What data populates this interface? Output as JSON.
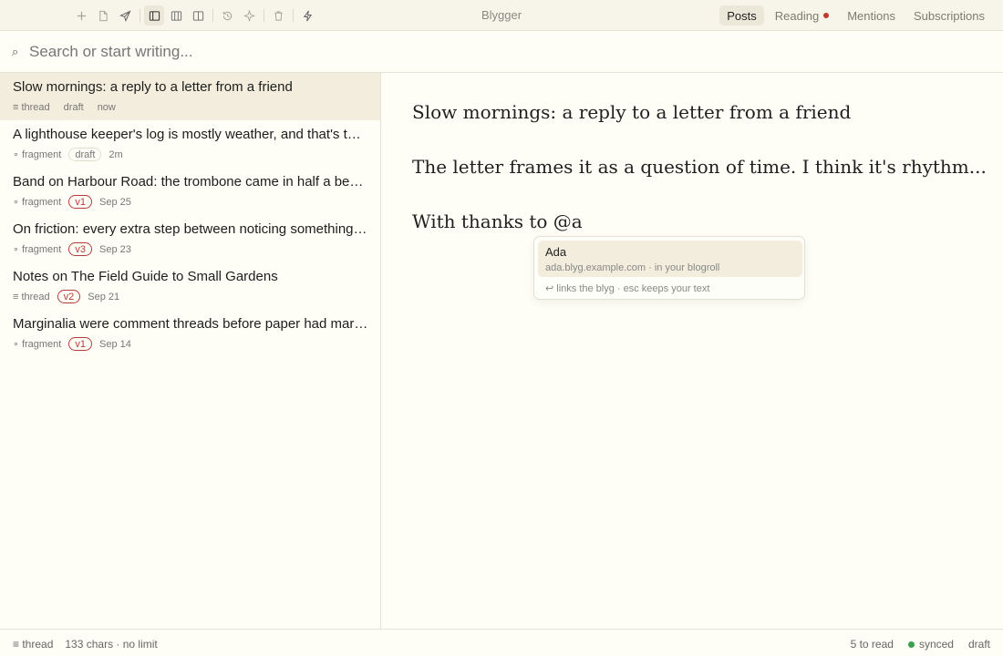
{
  "app": {
    "title": "Blygger"
  },
  "toolbar": {
    "icons": [
      "plus-icon",
      "document-icon",
      "send-icon",
      "sidebar-layout-icon",
      "columns-layout-icon",
      "split-layout-icon",
      "history-icon",
      "sparkle-icon",
      "trash-icon",
      "lightning-icon"
    ]
  },
  "nav": {
    "tabs": [
      {
        "label": "Posts",
        "active": true
      },
      {
        "label": "Reading",
        "active": false,
        "has_unread": true
      },
      {
        "label": "Mentions",
        "active": false
      },
      {
        "label": "Subscriptions",
        "active": false
      }
    ]
  },
  "colors": {
    "accent_red": "#b63b3b",
    "unread_dot": "#c0392b",
    "synced_dot": "#3aa04f",
    "selected_bg": "#f2eddc"
  },
  "search": {
    "placeholder": "Search or start writing...",
    "icon": "⌕"
  },
  "posts": [
    {
      "title": "Slow mornings: a reply to a letter from a friend",
      "kind": "≡ thread",
      "badge": "draft",
      "badge_type": "draft",
      "time": "now",
      "selected": true
    },
    {
      "title": "A lighthouse keeper's log is mostly weather, and that's the point",
      "kind": "∘ fragment",
      "badge": "draft",
      "badge_type": "draft",
      "time": "2m",
      "selected": false
    },
    {
      "title": "Band on Harbour Road: the trombone came in half a beat late",
      "kind": "∘ fragment",
      "badge": "v1",
      "badge_type": "ver",
      "time": "Sep 25",
      "selected": false
    },
    {
      "title": "On friction: every extra step between noticing something and writing it",
      "kind": "∘ fragment",
      "badge": "v3",
      "badge_type": "ver",
      "time": "Sep 23",
      "selected": false
    },
    {
      "title": "Notes on The Field Guide to Small Gardens",
      "kind": "≡ thread",
      "badge": "v2",
      "badge_type": "ver",
      "time": "Sep 21",
      "selected": false
    },
    {
      "title": "Marginalia were comment threads before paper had margins to spare",
      "kind": "∘ fragment",
      "badge": "v1",
      "badge_type": "ver",
      "time": "Sep 14",
      "selected": false
    }
  ],
  "editor": {
    "paragraphs": [
      "Slow mornings: a reply to a letter from a friend",
      "The letter frames it as a question of time. I think it's rhythm...",
      "With thanks to @a"
    ]
  },
  "mention_popup": {
    "suggestion_name": "Ada",
    "suggestion_detail": "ada.blyg.example.com · in your blogroll",
    "hint": "↩ links the blyg · esc keeps your text"
  },
  "status": {
    "kind": "≡ thread",
    "chars": "133 chars · no limit",
    "to_read": "5 to read",
    "sync": "synced",
    "state": "draft"
  }
}
